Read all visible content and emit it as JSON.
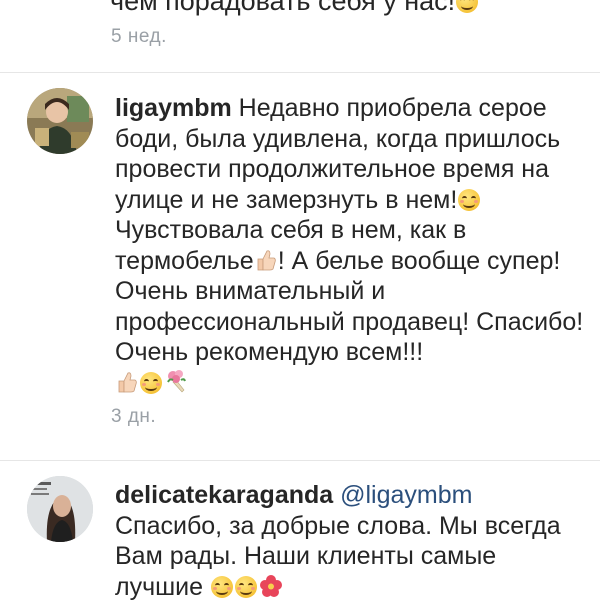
{
  "previous_comment": {
    "text_fragment": "чем порадовать себя у нас!",
    "timestamp": "5 нед."
  },
  "comments": [
    {
      "username": "ligaymbm",
      "body_parts": [
        "Недавно приобрела серое боди, была удивлена, когда пришлось провести продолжительное время на улице и не замерзнуть в нем!",
        "Чувствовала себя в нем, как в термобелье",
        "! А белье вообще супер! Очень внимательный и профессиональный продавец! Спасибо! Очень рекомендую всем!!!"
      ],
      "emoji": [
        "smiling-face",
        "thumbs-up",
        "thumbs-up",
        "smiling-face",
        "bouquet"
      ],
      "timestamp": "3 дн."
    },
    {
      "username": "delicatekaraganda",
      "mention": "@ligaymbm",
      "body": "Спасибо, за добрые слова. Мы всегда Вам рады. Наши клиенты самые лучшие",
      "emoji": [
        "smiling-face",
        "smiling-face",
        "flower"
      ]
    }
  ],
  "colors": {
    "text": "#262626",
    "muted": "#9aa0a6",
    "mention": "#2b4f7c",
    "divider": "#e6e6e6"
  }
}
